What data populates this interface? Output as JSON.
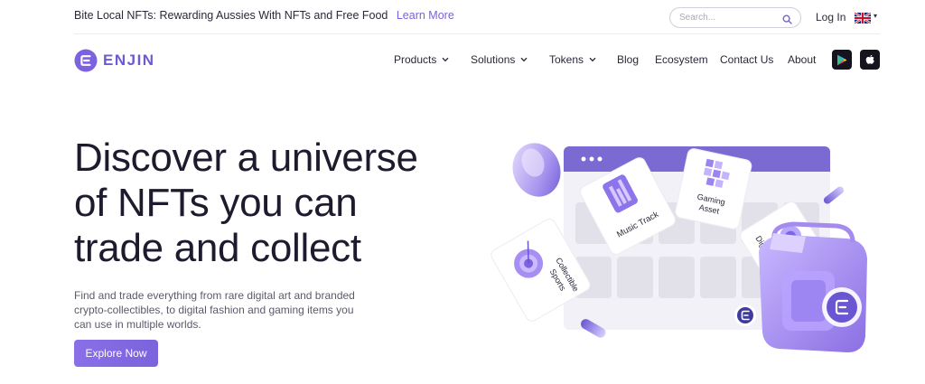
{
  "announcement": {
    "text": "Bite Local NFTs: Rewarding Aussies With NFTs and Free Food",
    "link": "Learn More"
  },
  "search": {
    "placeholder": "Search..."
  },
  "auth": {
    "login": "Log In"
  },
  "language": {
    "flag": "uk-flag-icon"
  },
  "brand": {
    "name": "ENJIN",
    "color": "#6e5ad6"
  },
  "nav": {
    "products": "Products",
    "solutions": "Solutions",
    "tokens": "Tokens",
    "blog": "Blog",
    "ecosystem": "Ecosystem",
    "contact": "Contact Us",
    "about": "About"
  },
  "stores": {
    "play": "google-play-icon",
    "apple": "apple-icon"
  },
  "hero": {
    "title_lines": [
      "Discover a universe",
      "of NFTs you can",
      "trade and collect"
    ],
    "subtitle": "Find and trade everything from rare digital art and branded crypto-collectibles, to digital fashion and gaming items you can use in multiple worlds.",
    "cta": "Explore Now"
  },
  "illustration": {
    "cards": {
      "music": "Music Track",
      "gaming_line1": "Gaming",
      "gaming_line2": "Asset",
      "digital": "Digital Art",
      "sports_line1": "Sports",
      "sports_line2": "Collectible"
    }
  },
  "colors": {
    "accent": "#7b61d9",
    "button": "#8a6fe8",
    "text": "#1f1b2e",
    "illustration_purple": "#7b6ad1"
  }
}
